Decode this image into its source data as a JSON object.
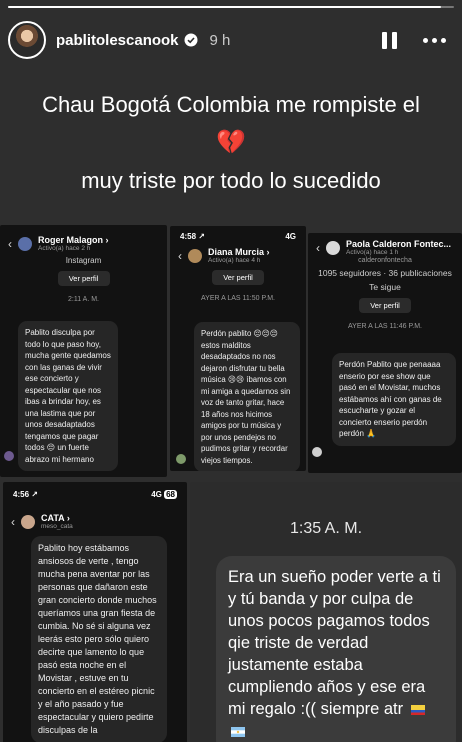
{
  "story": {
    "progress": 0.97,
    "username": "pablitolescanook",
    "time": "9 h",
    "caption_line1": "Chau Bogotá Colombia me rompiste el",
    "caption_emoji": "💔",
    "caption_line2": "muy triste por todo lo sucedido"
  },
  "shot1": {
    "name": "Roger Malagon ›",
    "sub": "Activo(a) hace 2 h",
    "platform": "Instagram",
    "button": "Ver perfil",
    "stamp": "2:11 A. M.",
    "message": "Pablito disculpa por todo lo que paso hoy, mucha gente quedamos con las ganas de vivir ese concierto y espectacular que nos ibas a brindar hoy, es una lastima que por unos desadaptados tengamos que pagar todos 😔 un fuerte abrazo mi hermano"
  },
  "shot2": {
    "clock": "4:58 ↗",
    "signal": "4G",
    "name": "Diana Murcia ›",
    "sub": "Activo(a) hace 4 h",
    "button": "Ver perfil",
    "stamp": "AYER A LAS 11:50 P.M.",
    "message": "Perdón pablito 😔😔😔 estos malditos desadaptados no nos dejaron disfrutar tu bella música 😢😢 íbamos con mi amiga a quedarnos sin voz de tanto gritar, hace 18 años nos hicimos amigos por tu música y por unos pendejos no pudimos gritar y recordar viejos tiempos."
  },
  "shot3": {
    "name": "Paola Calderon Fontec...",
    "sub": "Activo(a) hace 1 h",
    "handle": "calderonfontecha",
    "stats": "1095 seguidores · 36 publicaciones",
    "follows": "Te sigue",
    "button": "Ver perfil",
    "stamp": "AYER A LAS 11:46 P.M.",
    "message": "Perdón Pablito que penaaaa enserio por ese show que pasó en el Movistar, muchos estábamos ahí con ganas de escucharte y gozar el concierto enserio perdón perdón 🙏"
  },
  "shot4": {
    "clock": "4:56 ↗",
    "signal": "4G",
    "battery": "68",
    "name": "CATA ›",
    "sub": "meso_cata",
    "message": "Pablito hoy estábamos ansiosos de verte , tengo mucha pena aventar por las personas que dañaron este gran concierto donde muchos queríamos una gran fiesta de cumbia. No sé si alguna vez leerás esto pero sólo quiero decirte que lamento lo que pasó esta noche en el Movistar , estuve en tu concierto en el estéreo picnic y el año pasado y fue espectacular y quiero pedirte disculpas de la"
  },
  "shot5": {
    "stamp": "1:35 A. M.",
    "message": "Era un sueño poder verte a ti y tú banda y por culpa de unos pocos pagamos todos qie triste de verdad justamente estaba cumpliendo años y ese era mi regalo :(( siempre atr"
  },
  "colors": {
    "background": "#2e2e2e",
    "card": "#121212",
    "bubble": "#262626",
    "heart": "#c1121f",
    "verified": "#ffffff"
  }
}
